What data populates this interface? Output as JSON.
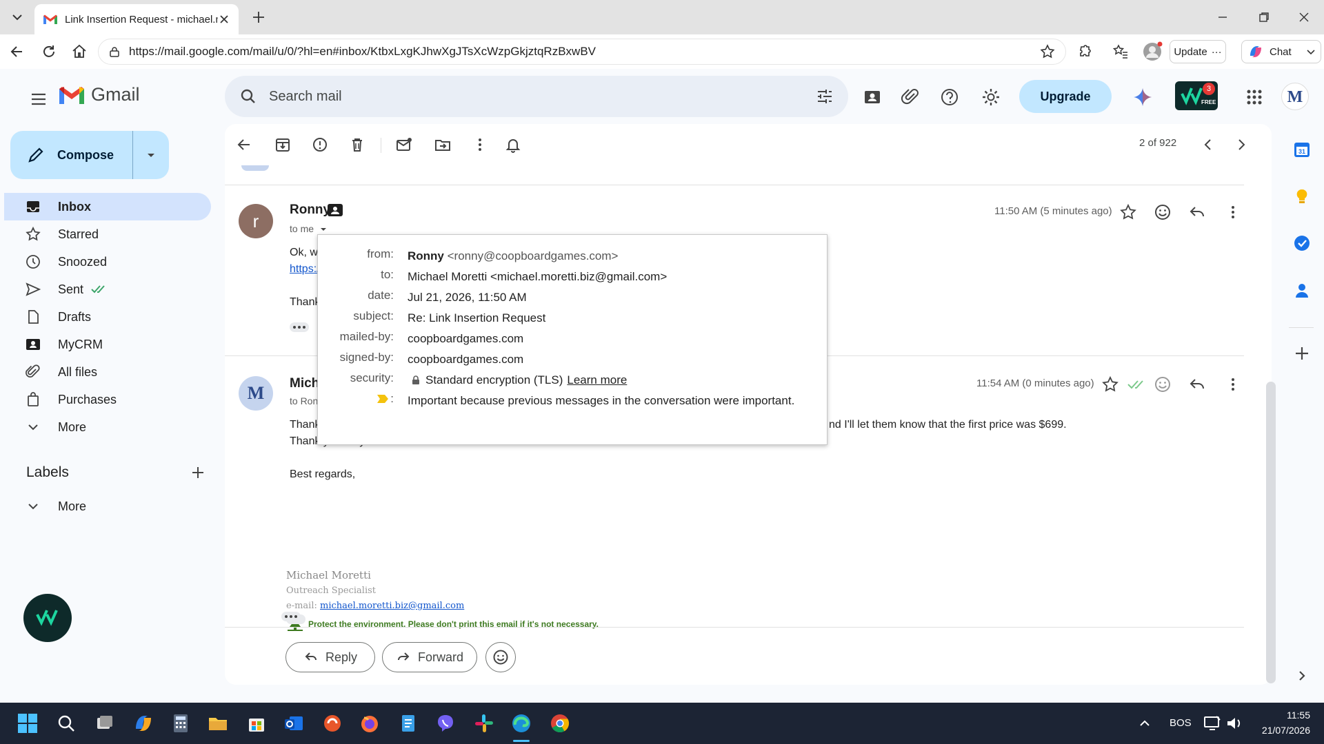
{
  "browser": {
    "tab_title": "Link Insertion Request - michael.m",
    "url": "https://mail.google.com/mail/u/0/?hl=en#inbox/KtbxLxgKJhwXgJTsXcWzpGkjztqRzBxwBV",
    "update_label": "Update",
    "chat_label": "Chat"
  },
  "gmail": {
    "app_name": "Gmail",
    "search_placeholder": "Search mail",
    "upgrade_label": "Upgrade",
    "extension_badge": "3",
    "extension_badge_text": "FREE",
    "account_initial": "M",
    "compose_label": "Compose",
    "nav": [
      {
        "label": "Inbox",
        "icon": "inbox-icon",
        "active": true
      },
      {
        "label": "Starred",
        "icon": "star-icon"
      },
      {
        "label": "Snoozed",
        "icon": "clock-icon"
      },
      {
        "label": "Sent",
        "icon": "send-icon"
      },
      {
        "label": "Drafts",
        "icon": "draft-icon"
      },
      {
        "label": "MyCRM",
        "icon": "contact-card-icon"
      },
      {
        "label": "All files",
        "icon": "paperclip-icon"
      },
      {
        "label": "Purchases",
        "icon": "shopping-bag-icon"
      },
      {
        "label": "More",
        "icon": "chevron-down-icon"
      }
    ],
    "labels_title": "Labels",
    "labels_more": "More"
  },
  "toolbar": {
    "pager": "2 of 922"
  },
  "messages": [
    {
      "avatar": "r",
      "sender": "Ronny",
      "to": "to me",
      "time": "11:50 AM (5 minutes ago)",
      "body_line1": "Ok, w",
      "body_link": "https:/",
      "body_line3": "Thank"
    },
    {
      "avatar": "M",
      "sender": "Micha",
      "to": "to Ron",
      "time": "11:54 AM (0 minutes ago)",
      "body_line1_start": "Thank",
      "body_line1_end": "nd I'll let them know that the first price was $699.",
      "body_line2": "Thank you very much.",
      "closing": "Best regards,",
      "sig_name": "Michael Moretti",
      "sig_title": "Outreach Specialist",
      "sig_email_label": "e-mail: ",
      "sig_email": "michael.moretti.biz@gmail.com",
      "sig_env": "Protect the environment. Please don't print this email if it's not necessary."
    }
  ],
  "popup": {
    "from_label": "from:",
    "from_name": "Ronny",
    "from_email": "<ronny@coopboardgames.com>",
    "to_label": "to:",
    "to_value": "Michael Moretti <michael.moretti.biz@gmail.com>",
    "date_label": "date:",
    "date_value": "Jul 21, 2026, 11:50 AM",
    "subject_label": "subject:",
    "subject_value": "Re: Link Insertion Request",
    "mailedby_label": "mailed-by:",
    "mailedby_value": "coopboardgames.com",
    "signedby_label": "signed-by:",
    "signedby_value": "coopboardgames.com",
    "security_label": "security:",
    "security_value": "Standard encryption (TLS)",
    "learn_more": "Learn more",
    "importance_label": ":",
    "importance_value": "Important because previous messages in the conversation were important."
  },
  "actions": {
    "reply": "Reply",
    "forward": "Forward"
  },
  "taskbar": {
    "lang": "BOS",
    "time": "11:55",
    "date": "21/07/2026"
  },
  "colors": {
    "accent": "#c2e7ff",
    "active_nav": "#d3e3fd",
    "link": "#1155cc",
    "taskbar": "#1c2434"
  }
}
